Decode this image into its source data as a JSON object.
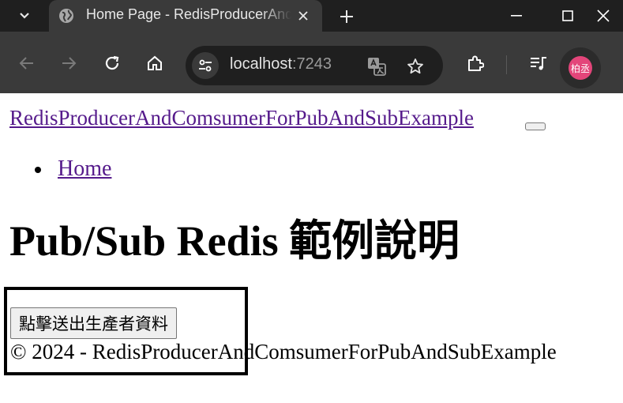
{
  "browser": {
    "tab_title": "Home Page - RedisProducerAndComsumerForPubAndSubExample",
    "url_host": "localhost",
    "url_port": ":7243",
    "avatar_text": "柏丞",
    "icons": [
      "tab-list-icon",
      "globe-icon",
      "close-icon",
      "plus-icon",
      "minimize-icon",
      "maximize-icon",
      "window-close-icon",
      "back-icon",
      "forward-icon",
      "reload-icon",
      "home-icon",
      "site-info-icon",
      "translate-icon",
      "star-icon",
      "extensions-icon",
      "media-icon"
    ]
  },
  "page": {
    "brand": "RedisProducerAndComsumerForPubAndSubExample",
    "nav": [
      {
        "label": "Home"
      }
    ],
    "heading": "Pub/Sub Redis 範例說明",
    "button_label": "點擊送出生產者資料",
    "footer": "© 2024 - RedisProducerAndComsumerForPubAndSubExample"
  }
}
